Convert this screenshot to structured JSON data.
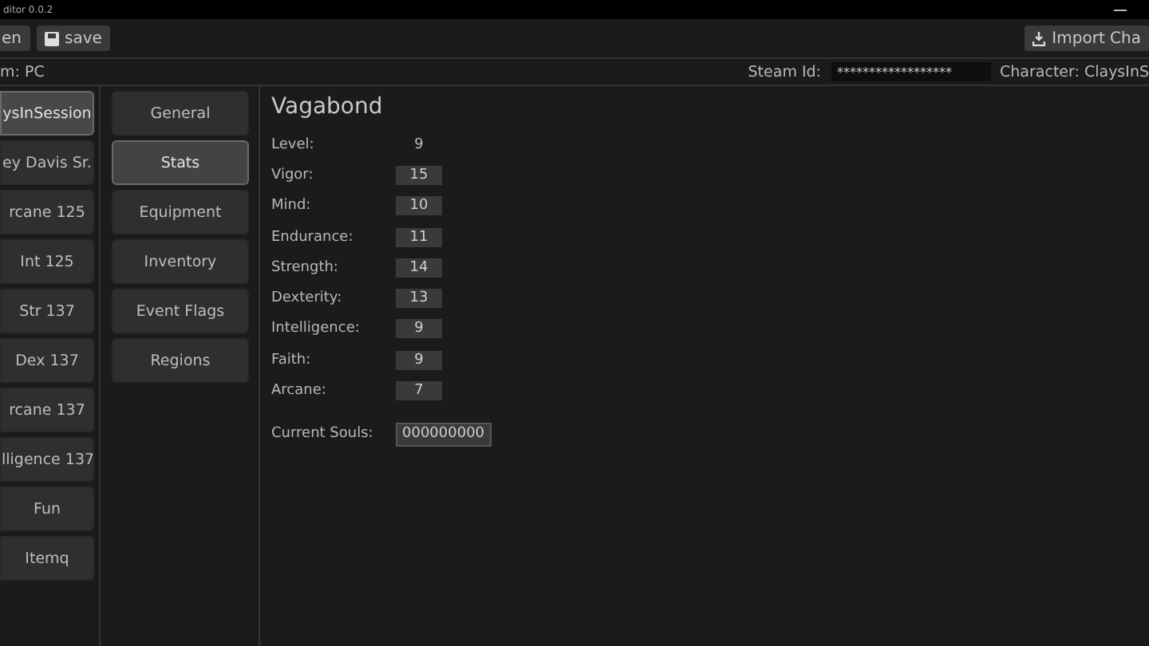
{
  "window": {
    "title": "ditor 0.0.2"
  },
  "toolbar": {
    "buttons": [
      {
        "label": "en",
        "kind": "plain"
      },
      {
        "label": "save",
        "kind": "save"
      }
    ],
    "import_button": "Import Cha"
  },
  "info_bar": {
    "platform": "m: PC",
    "steam_id_label": "Steam Id:",
    "steam_id_value": "******************",
    "character": "Character: ClaysInS"
  },
  "characters": [
    {
      "label": "ysInSession",
      "selected": true
    },
    {
      "label": "ey Davis Sr.",
      "selected": false
    },
    {
      "label": "rcane 125",
      "selected": false
    },
    {
      "label": "Int 125",
      "selected": false
    },
    {
      "label": "Str 137",
      "selected": false
    },
    {
      "label": "Dex 137",
      "selected": false
    },
    {
      "label": "rcane 137",
      "selected": false
    },
    {
      "label": "lligence 137",
      "selected": false
    },
    {
      "label": "Fun",
      "selected": false
    },
    {
      "label": "Itemq",
      "selected": false
    }
  ],
  "tabs": [
    {
      "label": "General",
      "selected": false
    },
    {
      "label": "Stats",
      "selected": true
    },
    {
      "label": "Equipment",
      "selected": false
    },
    {
      "label": "Inventory",
      "selected": false
    },
    {
      "label": "Event Flags",
      "selected": false
    },
    {
      "label": "Regions",
      "selected": false
    }
  ],
  "stats": {
    "class_name": "Vagabond",
    "rows": [
      {
        "label": "Level:",
        "value": "9",
        "kind": "text"
      },
      {
        "label": "Vigor:",
        "value": "15",
        "kind": "field"
      },
      {
        "label": "Mind:",
        "value": "10",
        "kind": "field"
      },
      {
        "label": "Endurance:",
        "value": "11",
        "kind": "field"
      },
      {
        "label": "Strength:",
        "value": "14",
        "kind": "field"
      },
      {
        "label": "Dexterity:",
        "value": "13",
        "kind": "field"
      },
      {
        "label": "Intelligence:",
        "value": "9",
        "kind": "field"
      },
      {
        "label": "Faith:",
        "value": "9",
        "kind": "field"
      },
      {
        "label": "Arcane:",
        "value": "7",
        "kind": "field"
      }
    ],
    "souls_label": "Current Souls:",
    "souls_value": "000000000"
  }
}
